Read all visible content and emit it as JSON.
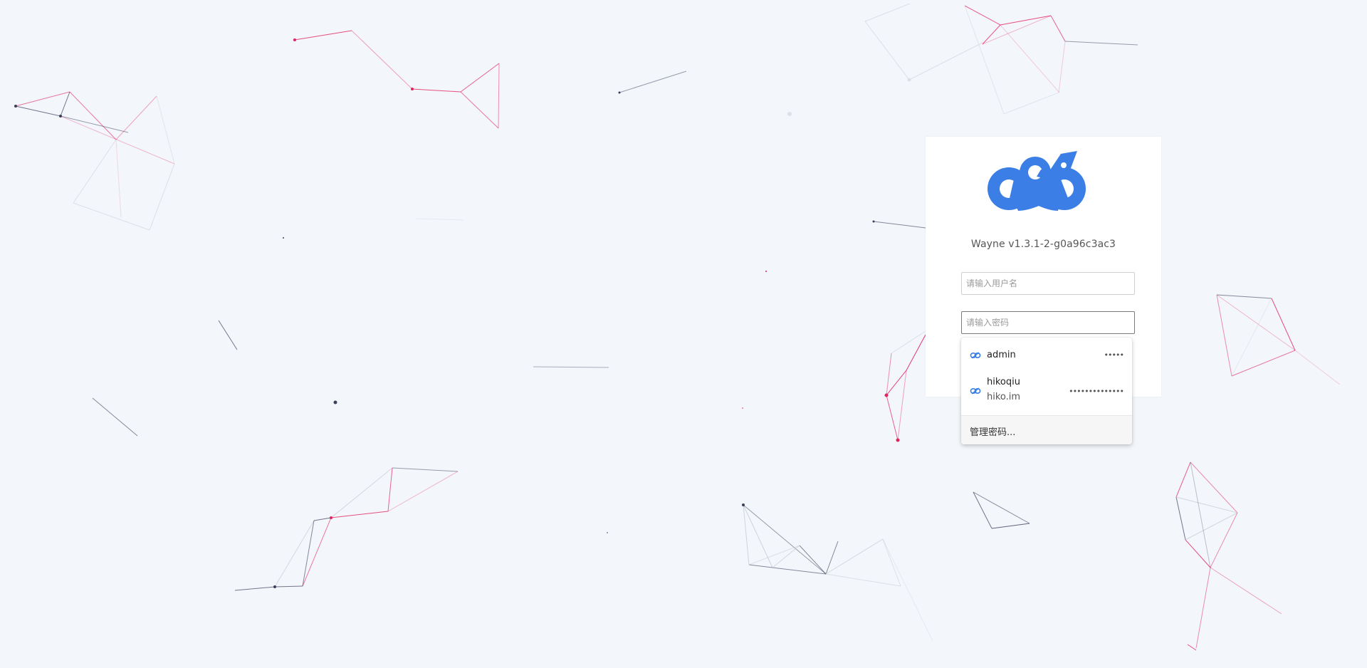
{
  "app": {
    "title": "Wayne v1.3.1-2-g0a96c3ac3",
    "brand_color": "#3a7ee6"
  },
  "form": {
    "username_placeholder": "请输入用户名",
    "password_placeholder": "请输入密码"
  },
  "autofill": {
    "items": [
      {
        "username": "admin",
        "site": "",
        "password_mask": "•••••"
      },
      {
        "username": "hikoqiu",
        "site": "hiko.im",
        "password_mask": "••••••••••••••"
      }
    ],
    "manage_label": "管理密码..."
  },
  "background": {
    "line_colors": [
      "#e2245f",
      "#3c3f5a",
      "#c7cad4"
    ]
  }
}
